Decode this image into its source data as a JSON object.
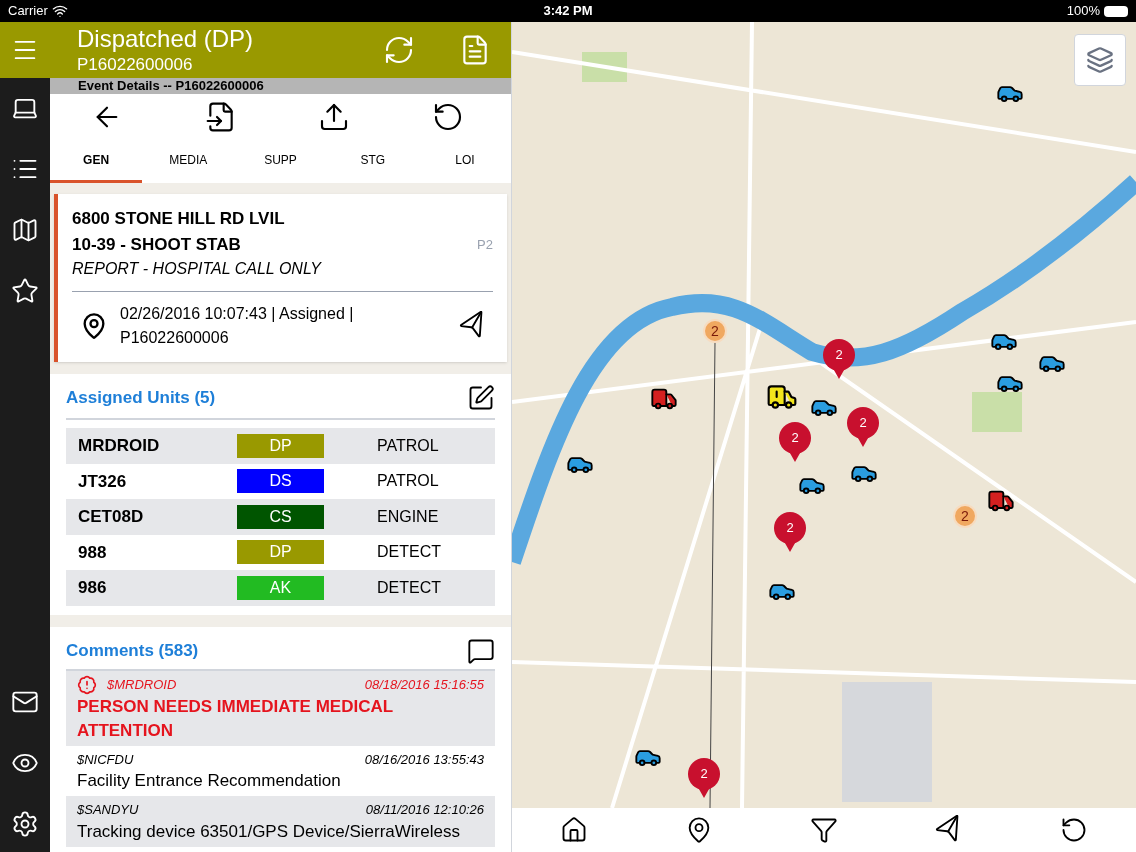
{
  "status_bar": {
    "carrier": "Carrier",
    "time": "3:42 PM",
    "battery": "100%"
  },
  "header": {
    "title": "Dispatched (DP)",
    "subtitle": "P16022600006"
  },
  "event_bar": {
    "title": "Event Details -- P16022600006"
  },
  "tabs": [
    {
      "label": "GEN",
      "selected": true
    },
    {
      "label": "MEDIA",
      "selected": false
    },
    {
      "label": "SUPP",
      "selected": false
    },
    {
      "label": "STG",
      "selected": false
    },
    {
      "label": "LOI",
      "selected": false
    }
  ],
  "event": {
    "address": "6800 STONE HILL RD LVIL",
    "type": "10-39 - SHOOT STAB",
    "priority": "P2",
    "note": "REPORT - HOSPITAL CALL ONLY",
    "location_line1": "02/26/2016 10:07:43 | Assigned |",
    "location_line2": "P16022600006"
  },
  "assigned_units": {
    "title": "Assigned Units (5)",
    "rows": [
      {
        "unit": "MRDROID",
        "status": "DP",
        "color": "#999900",
        "type": "PATROL"
      },
      {
        "unit": "JT326",
        "status": "DS",
        "color": "#0000ff",
        "type": "PATROL"
      },
      {
        "unit": "CET08D",
        "status": "CS",
        "color": "#005500",
        "type": "ENGINE"
      },
      {
        "unit": "988",
        "status": "DP",
        "color": "#999900",
        "type": "DETECT"
      },
      {
        "unit": "986",
        "status": "AK",
        "color": "#22bb22",
        "type": "DETECT"
      }
    ]
  },
  "comments": {
    "title": "Comments (583)",
    "items": [
      {
        "author": "$MRDROID",
        "time": "08/18/2016 15:16:55",
        "text": "PERSON NEEDS IMMEDIATE MEDICAL ATTENTION",
        "urgent": true
      },
      {
        "author": "$NICFDU",
        "time": "08/16/2016 13:55:43",
        "text": "Facility Entrance Recommendation",
        "urgent": false
      },
      {
        "author": "$SANDYU",
        "time": "08/11/2016 12:10:26",
        "text": "Tracking device 63501/GPS Device/SierraWireless",
        "urgent": false
      }
    ]
  },
  "map": {
    "markers": [
      {
        "kind": "cluster",
        "label": "2"
      },
      {
        "kind": "pin",
        "label": "2"
      },
      {
        "kind": "pin",
        "label": "2"
      },
      {
        "kind": "pin",
        "label": "2"
      },
      {
        "kind": "cluster",
        "label": "2"
      },
      {
        "kind": "pin",
        "label": "2"
      },
      {
        "kind": "pin",
        "label": "2"
      }
    ]
  }
}
